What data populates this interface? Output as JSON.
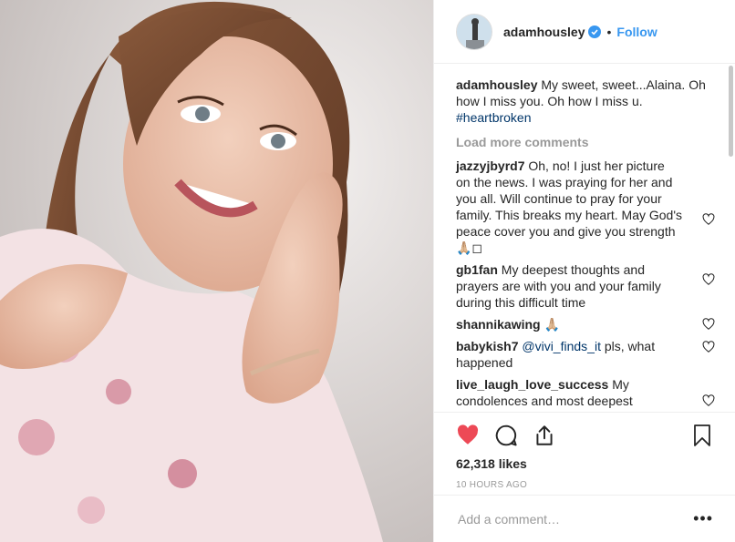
{
  "header": {
    "username": "adamhousley",
    "separator": "•",
    "follow_label": "Follow"
  },
  "caption": {
    "username": "adamhousley",
    "text": " My sweet, sweet...Alaina. Oh how I miss you. Oh how I miss u. ",
    "hashtag": "#heartbroken"
  },
  "load_more_label": "Load more comments",
  "comments": [
    {
      "username": "jazzyjbyrd7",
      "text": " Oh, no! I just her picture on the news. I was praying for her and you all. Will continue to pray for your family. This breaks my heart. May God's peace cover you and give you strength 🙏🏼◻"
    },
    {
      "username": "gb1fan",
      "text": " My deepest thoughts and prayers are with you and your family during this difficult time"
    },
    {
      "username": "shannikawing",
      "text": " 🙏🏼"
    },
    {
      "username": "babykish7",
      "mention": "@vivi_finds_it",
      "text": " pls, what happened"
    },
    {
      "username": "live_laugh_love_success",
      "text": " My condolences and most deepest"
    }
  ],
  "likes": "62,318 likes",
  "timestamp": "10 HOURS AGO",
  "comment_input": {
    "placeholder": "Add a comment…"
  },
  "more_label": "•••",
  "icons": {
    "like": "heart-filled-icon",
    "comment": "comment-icon",
    "share": "share-icon",
    "save": "bookmark-icon",
    "verified": "verified-badge-icon"
  },
  "colors": {
    "like_red": "#ed4956",
    "link_blue": "#3897f0",
    "hashtag_blue": "#003569",
    "muted_gray": "#999999"
  }
}
